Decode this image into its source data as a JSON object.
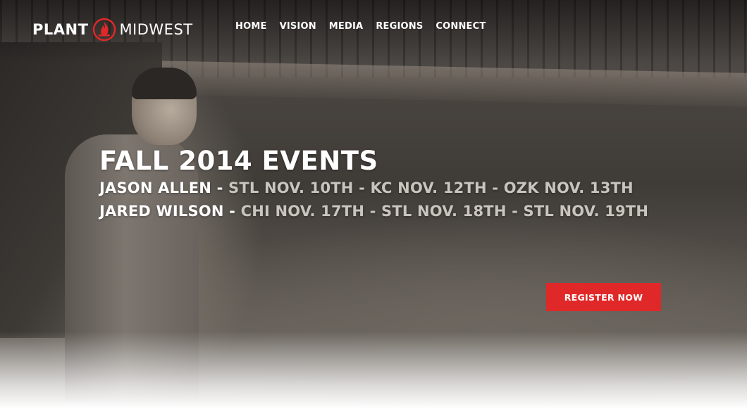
{
  "logo": {
    "word1": "PLANT",
    "word2": "MIDWEST",
    "icon": "flame-icon",
    "accent_color": "#e02828"
  },
  "nav": {
    "items": [
      {
        "label": "HOME"
      },
      {
        "label": "VISION"
      },
      {
        "label": "MEDIA"
      },
      {
        "label": "REGIONS"
      },
      {
        "label": "CONNECT"
      }
    ]
  },
  "hero": {
    "title": "FALL 2014 EVENTS",
    "speakers": [
      {
        "name": "JASON ALLEN -",
        "dates": "STL NOV. 10TH - KC NOV. 12TH - OZK NOV. 13TH"
      },
      {
        "name": "JARED WILSON -",
        "dates": "CHI NOV. 17TH - STL NOV. 18TH - STL NOV. 19TH"
      }
    ],
    "cta_label": "REGISTER NOW",
    "cta_color": "#e02828"
  }
}
